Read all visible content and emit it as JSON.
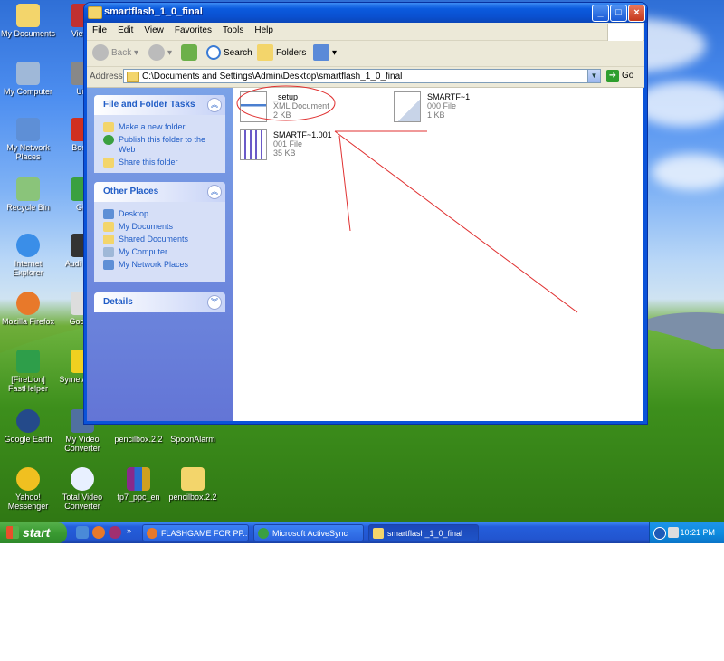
{
  "desktop": {
    "icons": [
      {
        "label": "My Documents",
        "icon": "folder-icon"
      },
      {
        "label": "My Computer",
        "icon": "computer-icon"
      },
      {
        "label": "My Network Places",
        "icon": "network-icon"
      },
      {
        "label": "Recycle Bin",
        "icon": "recycle-bin-icon"
      },
      {
        "label": "Internet Explorer",
        "icon": "ie-icon"
      },
      {
        "label": "Mozilla Firefox",
        "icon": "firefox-icon"
      },
      {
        "label": "[FireLion] FastHelper",
        "icon": "shield-icon"
      },
      {
        "label": "Google Earth",
        "icon": "globe-icon"
      },
      {
        "label": "Yahoo! Messenger",
        "icon": "smiley-icon"
      },
      {
        "label": "Viewe",
        "icon": "shortcut-icon"
      },
      {
        "label": "Unl",
        "icon": "shortcut-icon"
      },
      {
        "label": "Boom",
        "icon": "shortcut-icon"
      },
      {
        "label": "Gig",
        "icon": "shortcut-icon"
      },
      {
        "label": "Audi Nitpi",
        "icon": "shortcut-icon"
      },
      {
        "label": "Google",
        "icon": "shortcut-icon"
      },
      {
        "label": "Syme AntiVir",
        "icon": "shortcut-icon"
      },
      {
        "label": "My Video Converter",
        "icon": "video-icon"
      },
      {
        "label": "pencilbox.2.2",
        "icon": "shortcut-icon"
      },
      {
        "label": "SpoonAlarm",
        "icon": "alarm-icon"
      },
      {
        "label": "Total Video Converter",
        "icon": "video-converter-icon"
      },
      {
        "label": "fp7_ppc_en",
        "icon": "archive-icon"
      },
      {
        "label": "pencilbox.2.2",
        "icon": "folder-icon"
      }
    ]
  },
  "window": {
    "title": "smartflash_1_0_final",
    "menu": [
      "File",
      "Edit",
      "View",
      "Favorites",
      "Tools",
      "Help"
    ],
    "toolbar": {
      "back": "Back",
      "search": "Search",
      "folders": "Folders"
    },
    "address": {
      "label": "Address",
      "value": "C:\\Documents and Settings\\Admin\\Desktop\\smartflash_1_0_final",
      "go": "Go"
    }
  },
  "tasks_panel": {
    "title": "File and Folder Tasks",
    "items": [
      "Make a new folder",
      "Publish this folder to the Web",
      "Share this folder"
    ]
  },
  "other_places": {
    "title": "Other Places",
    "items": [
      "Desktop",
      "My Documents",
      "Shared Documents",
      "My Computer",
      "My Network Places"
    ]
  },
  "details": {
    "title": "Details"
  },
  "files": [
    {
      "name": "_setup",
      "type": "XML Document",
      "size": "2 KB"
    },
    {
      "name": "SMARTF~1",
      "type": "000 File",
      "size": "1 KB"
    },
    {
      "name": "SMARTF~1.001",
      "type": "001 File",
      "size": "35 KB"
    }
  ],
  "taskbar": {
    "start": "start",
    "tasks": [
      "FLASHGAME FOR PP...",
      "Microsoft ActiveSync",
      "smartflash_1_0_final"
    ],
    "clock": "10:21 PM"
  },
  "colors": {
    "annotation": "#e03030",
    "xp_blue": "#0a53d9",
    "panel_link": "#215dc6"
  }
}
